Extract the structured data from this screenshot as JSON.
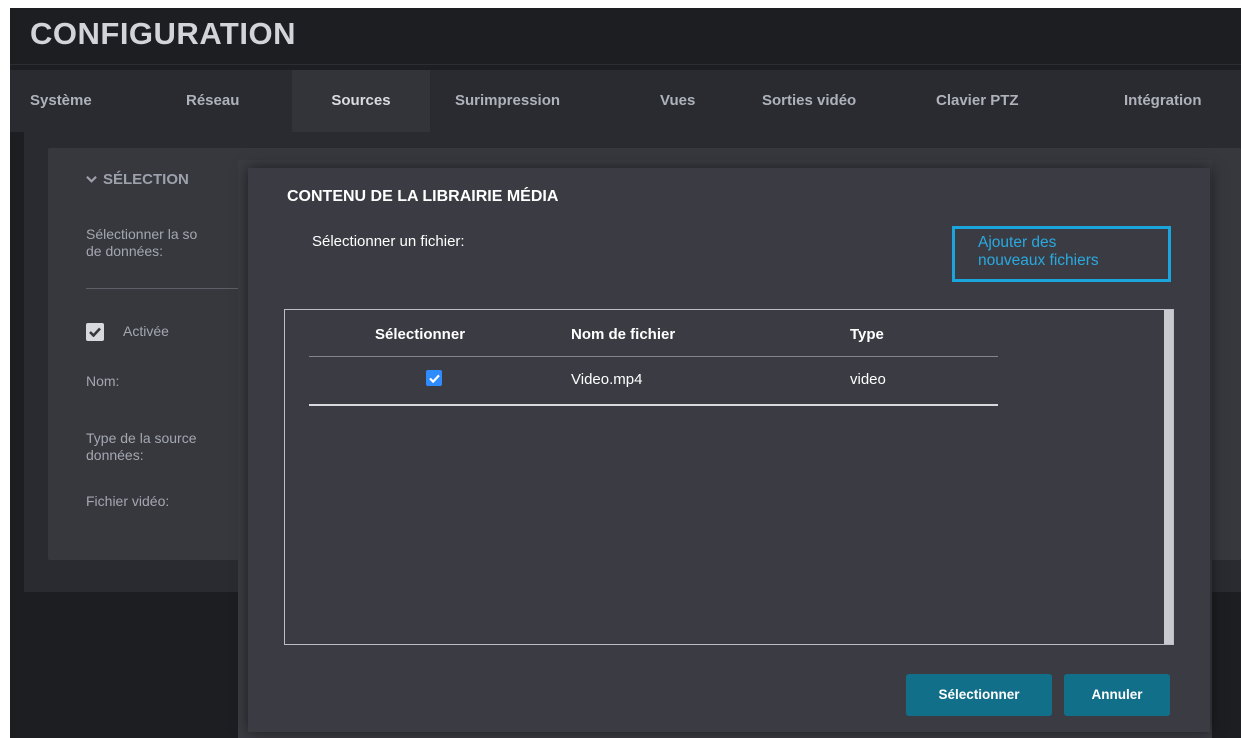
{
  "page": {
    "title": "CONFIGURATION"
  },
  "tabs": [
    {
      "label": "Système"
    },
    {
      "label": "Réseau"
    },
    {
      "label": "Sources"
    },
    {
      "label": "Surimpression"
    },
    {
      "label": "Vues"
    },
    {
      "label": "Sorties vidéo"
    },
    {
      "label": "Clavier PTZ"
    },
    {
      "label": "Intégration"
    }
  ],
  "active_tab": "Sources",
  "background_panel": {
    "section_title": "SÉLECTION",
    "select_source_label": "Sélectionner la so\nde données:",
    "enabled_checked": true,
    "enabled_label": "Activée",
    "name_label": "Nom:",
    "source_type_label": "Type de la source\ndonnées:",
    "video_file_label": "Fichier vidéo:"
  },
  "modal": {
    "title": "CONTENU DE LA LIBRAIRIE MÉDIA",
    "subtitle": "Sélectionner un fichier:",
    "add_files_label": "Ajouter des\nnouveaux fichiers",
    "columns": [
      "Sélectionner",
      "Nom de fichier",
      "Type"
    ],
    "files": [
      {
        "selected": true,
        "name": "Video.mp4",
        "type": "video"
      }
    ],
    "select_button": "Sélectionner",
    "cancel_button": "Annuler"
  },
  "colors": {
    "accent_blue": "#1aa6dd",
    "button_teal": "#126f8a",
    "checkbox_blue": "#2f8cff",
    "modal_bg": "#3b3c43",
    "app_bg": "#1d1e22"
  },
  "icons": {
    "section_chevron": "chevron-down-icon",
    "checkbox_check": "check-icon"
  }
}
